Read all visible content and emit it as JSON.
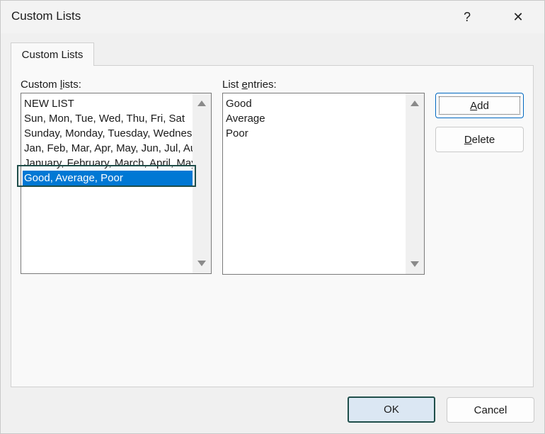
{
  "window": {
    "title": "Custom Lists",
    "help_glyph": "?",
    "close_glyph": "✕"
  },
  "tab": {
    "label": "Custom Lists"
  },
  "custom_lists": {
    "label_prefix": "Custom ",
    "label_accel": "l",
    "label_suffix": "ists:",
    "items": [
      "NEW LIST",
      "Sun, Mon, Tue, Wed, Thu, Fri, Sat",
      "Sunday, Monday, Tuesday, Wednesday, Thursday, Friday, Saturday",
      "Jan, Feb, Mar, Apr, May, Jun, Jul, Aug, Sep, Oct, Nov, Dec",
      "January, February, March, April, May, June, July, August, September, October, November, December",
      "Good, Average, Poor"
    ],
    "selected_index": 5
  },
  "list_entries": {
    "label_prefix": "List ",
    "label_accel": "e",
    "label_suffix": "ntries:",
    "items": [
      "Good",
      "Average",
      "Poor"
    ]
  },
  "buttons": {
    "add_accel": "A",
    "add_rest": "dd",
    "delete_accel": "D",
    "delete_rest": "elete",
    "ok": "OK",
    "cancel": "Cancel"
  },
  "colors": {
    "selection": "#0078d4",
    "highlight_border": "#1f4e4a"
  }
}
